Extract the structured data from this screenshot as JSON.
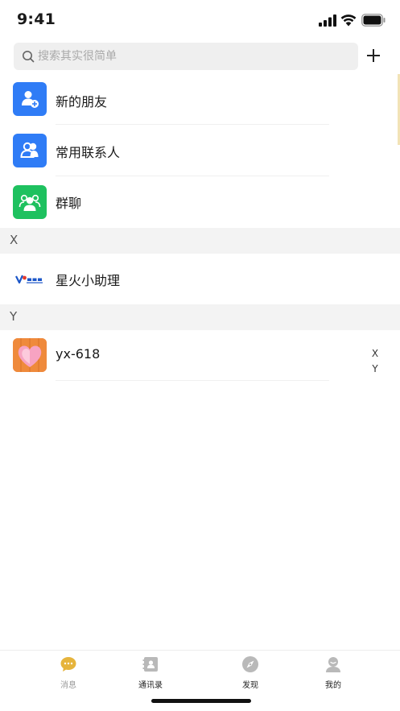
{
  "status_bar": {
    "time": "9:41"
  },
  "search": {
    "placeholder": "搜索其实很简单"
  },
  "entries": [
    {
      "label": "新的朋友",
      "icon": "add-friend-icon",
      "color": "#2f7cf6"
    },
    {
      "label": "常用联系人",
      "icon": "contacts-icon",
      "color": "#2f7cf6"
    },
    {
      "label": "群聊",
      "icon": "group-chat-icon",
      "color": "#1ec15f"
    }
  ],
  "sections": [
    {
      "letter": "X",
      "contacts": [
        {
          "name": "星火小助理",
          "avatar": "xinghuo-logo"
        }
      ]
    },
    {
      "letter": "Y",
      "contacts": [
        {
          "name": "yx-618",
          "avatar": "heart-avatar"
        }
      ]
    }
  ],
  "alpha_index": [
    "X",
    "Y"
  ],
  "tabs": [
    {
      "label": "消息",
      "icon": "message-icon",
      "active": false
    },
    {
      "label": "通讯录",
      "icon": "contacts-book-icon",
      "active": true
    },
    {
      "label": "发现",
      "icon": "compass-icon",
      "active": false
    },
    {
      "label": "我的",
      "icon": "profile-icon",
      "active": false
    }
  ],
  "colors": {
    "accent": "#e6b43c",
    "blue": "#2f7cf6",
    "green": "#1ec15f"
  }
}
